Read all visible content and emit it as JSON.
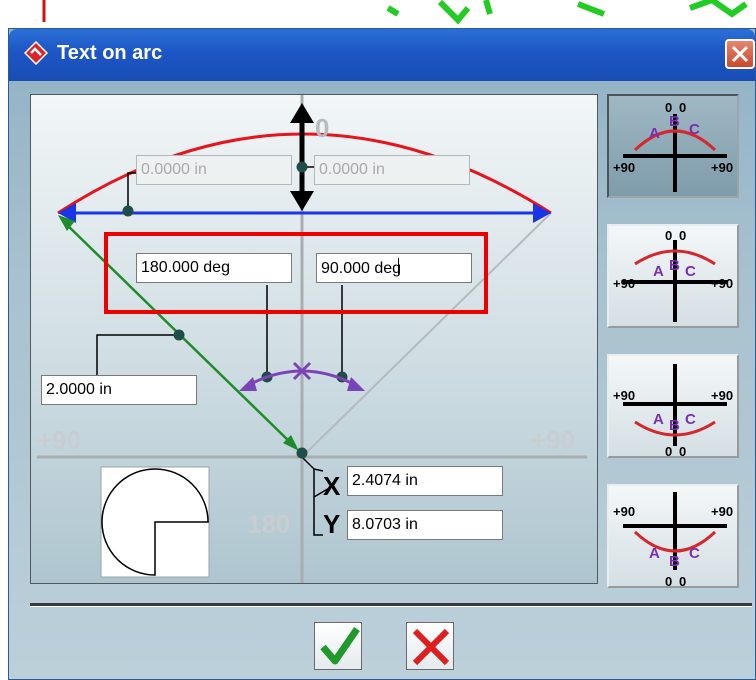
{
  "window": {
    "title": "Text on arc",
    "icon": "app-logo-icon",
    "close_icon": "close-icon"
  },
  "diagram": {
    "top_label": "0",
    "left_label": "+90",
    "right_label": "+90",
    "bottom_label": "180",
    "x_label": "X",
    "y_label": "Y"
  },
  "fields": {
    "left_offset": "0.0000 in",
    "right_offset": "0.0000 in",
    "start_angle": "180.000 deg",
    "end_angle": "90.000 deg",
    "radius": "2.0000 in",
    "center_x": "2.4074 in",
    "center_y": "8.0703 in"
  },
  "mode_buttons": [
    {
      "name": "outside-top",
      "top_label": "0",
      "left_label": "+90",
      "right_label": "+90",
      "text": "ABC",
      "active": true
    },
    {
      "name": "inside-top",
      "top_label": "0",
      "left_label": "+90",
      "right_label": "+90",
      "text": "ABC",
      "active": false
    },
    {
      "name": "inside-bottom",
      "bottom_label": "0",
      "left_label": "+90",
      "right_label": "+90",
      "text": "ABC",
      "active": false
    },
    {
      "name": "outside-bottom",
      "bottom_label": "0",
      "left_label": "+90",
      "right_label": "+90",
      "text": "ABC",
      "active": false
    }
  ],
  "actions": {
    "ok_icon": "checkmark-icon",
    "cancel_icon": "cross-icon"
  },
  "colors": {
    "arc": "#e8141c",
    "chord": "#1a35e8",
    "radius_line": "#1f8c2a",
    "angle_marker": "#7a44b8",
    "highlight": "#ee0000",
    "titlebar": "#1d56c5"
  }
}
